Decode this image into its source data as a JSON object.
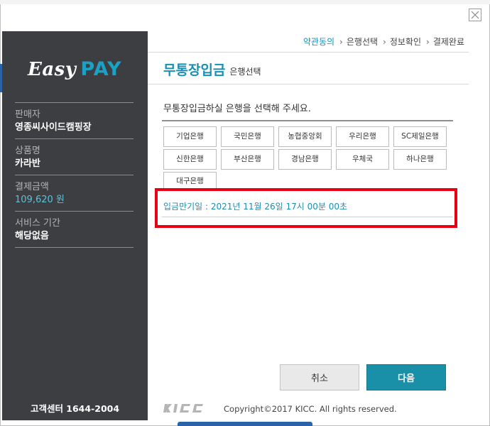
{
  "window": {
    "close_label": "close"
  },
  "logo": {
    "easy": "Easy",
    "pay": "PAY"
  },
  "sidebar": {
    "info": [
      {
        "label": "판매자",
        "value": "영종씨사이드캠핑장"
      },
      {
        "label": "상품명",
        "value": "카라반"
      },
      {
        "label": "결제금액",
        "value": "109,620 원"
      },
      {
        "label": "서비스 기간",
        "value": "해당없음"
      }
    ],
    "footer": "고객센터 1644-2004"
  },
  "steps": [
    {
      "label": "약관동의"
    },
    {
      "label": "은행선택"
    },
    {
      "label": "정보확인"
    },
    {
      "label": "결제완료"
    }
  ],
  "page": {
    "title": "무통장입금",
    "subtitle": "은행선택",
    "instruction": "무통장입금하실 은행을 선택해 주세요."
  },
  "banks": [
    "기업은행",
    "국민은행",
    "농협중앙회",
    "우리은행",
    "SC제일은행",
    "신한은행",
    "부산은행",
    "경남은행",
    "우체국",
    "하나은행",
    "대구은행"
  ],
  "deadline": "입금만기일 : 2021년 11월 26일 17시 00분 00초",
  "buttons": {
    "cancel": "취소",
    "next": "다음"
  },
  "footer": {
    "brand": "KICC",
    "copyright": "Copyright©2017 KICC. All rights reserved."
  },
  "colors": {
    "accent": "#1a8fb4",
    "sidebar_bg": "#3c3e41",
    "highlight": "#e60012",
    "next_button": "#1a8fa8"
  }
}
